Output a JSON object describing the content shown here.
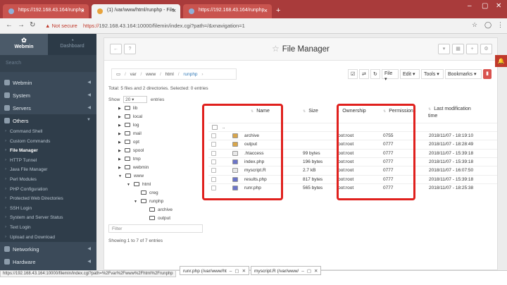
{
  "browser": {
    "tabs": [
      {
        "label": "https://192.168.43.164/runphp",
        "active": false
      },
      {
        "label": "(1) /var/www/html/runphp - File",
        "active": true
      },
      {
        "label": "https://192.168.43.164/runphp",
        "active": false
      }
    ],
    "secure_label": "Not secure",
    "url_scheme": "https://",
    "url_rest": "192.168.43.164:10000/filemin/index.cgi?path=/&xnavigation=1"
  },
  "sidebar": {
    "brand": "Webmin",
    "dashboard": "Dashboard",
    "search_placeholder": "Search",
    "categories": [
      {
        "label": "Webmin"
      },
      {
        "label": "System"
      },
      {
        "label": "Servers"
      },
      {
        "label": "Others"
      }
    ],
    "others_items": [
      {
        "label": "Command Shell"
      },
      {
        "label": "Custom Commands"
      },
      {
        "label": "File Manager"
      },
      {
        "label": "HTTP Tunnel"
      },
      {
        "label": "Java File Manager"
      },
      {
        "label": "Perl Modules"
      },
      {
        "label": "PHP Configuration"
      },
      {
        "label": "Protected Web Directories"
      },
      {
        "label": "SSH Login"
      },
      {
        "label": "System and Server Status"
      },
      {
        "label": "Text Login"
      },
      {
        "label": "Upload and Download"
      }
    ],
    "bottom_categories": [
      {
        "label": "Networking"
      },
      {
        "label": "Hardware"
      }
    ]
  },
  "file_manager": {
    "title": "File Manager",
    "breadcrumb": [
      "var",
      "www",
      "html",
      "runphp"
    ],
    "menus": [
      "File",
      "Edit",
      "Tools",
      "Bookmarks"
    ],
    "totals": "Total: 5 files and 2 directories. Selected: 0 entries",
    "show_label": "Show",
    "show_value": "20",
    "entries_label": "entries",
    "filter_placeholder": "Filter",
    "showing": "Showing 1 to 7 of 7 entries",
    "tree": [
      "lib",
      "local",
      "log",
      "mail",
      "opt",
      "spool",
      "tmp",
      "webmin",
      "www",
      "html",
      "creg",
      "runphp",
      "archive",
      "output"
    ],
    "columns": {
      "name": "Name",
      "size": "Size",
      "ownership": "Ownership",
      "permissions": "Permissions",
      "modified": "Last modification time"
    },
    "up_dir": "..",
    "files": [
      {
        "name": "archive",
        "size": "",
        "owner": "root:root",
        "perm": "0755",
        "mod": "2018/11/07 - 18:19:10",
        "kind": "folder"
      },
      {
        "name": "output",
        "size": "",
        "owner": "root:root",
        "perm": "0777",
        "mod": "2018/11/07 - 18:28:49",
        "kind": "folder"
      },
      {
        "name": ".htaccess",
        "size": "99 bytes",
        "owner": "root:root",
        "perm": "0777",
        "mod": "2018/11/07 - 15:39:18",
        "kind": "file"
      },
      {
        "name": "index.php",
        "size": "196 bytes",
        "owner": "root:root",
        "perm": "0777",
        "mod": "2018/11/07 - 15:39:18",
        "kind": "php"
      },
      {
        "name": "myscript.R",
        "size": "2.7 kB",
        "owner": "root:root",
        "perm": "0777",
        "mod": "2018/11/07 - 16:07:50",
        "kind": "file"
      },
      {
        "name": "results.php",
        "size": "817 bytes",
        "owner": "root:root",
        "perm": "0777",
        "mod": "2018/11/07 - 15:39:18",
        "kind": "php"
      },
      {
        "name": "runr.php",
        "size": "565 bytes",
        "owner": "root:root",
        "perm": "0777",
        "mod": "2018/11/07 - 18:25:38",
        "kind": "php"
      }
    ]
  },
  "statusbar": {
    "url": "https://192.168.43.164:10000/filemin/index.cgi?path=%2Fvar%2Fwww%2Fhtml%2Frunphp",
    "dock_items": [
      {
        "label": "runr.php (/var/www/ht"
      },
      {
        "label": "myscript.R (/var/www/"
      }
    ]
  },
  "colors": {
    "accent_red": "#e0201d",
    "chrome_red": "#a93b3b",
    "sidebar_bg": "#3b4a59"
  }
}
